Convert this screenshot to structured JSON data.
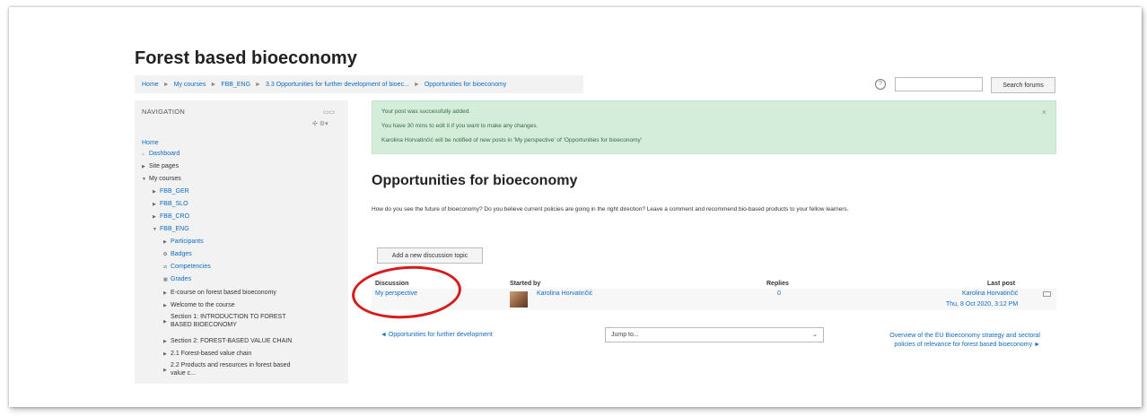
{
  "site": {
    "title": "Forest based bioeconomy"
  },
  "breadcrumb": [
    "Home",
    "My courses",
    "FBB_ENG",
    "3.3 Opportunities for further development of bioec...",
    "Opportunities for bioeconomy"
  ],
  "search": {
    "button_label": "Search forums",
    "placeholder": "",
    "help_glyph": "?"
  },
  "navigation": {
    "title": "NAVIGATION",
    "items": [
      {
        "label": "Home"
      },
      {
        "label": "Dashboard"
      },
      {
        "label": "Site pages"
      },
      {
        "label": "My courses"
      },
      {
        "label": "FBB_GER"
      },
      {
        "label": "FBB_SLO"
      },
      {
        "label": "FBB_CRO"
      },
      {
        "label": "FBB_ENG"
      },
      {
        "label": "Participants"
      },
      {
        "label": "Badges"
      },
      {
        "label": "Competencies"
      },
      {
        "label": "Grades"
      },
      {
        "label": "E-course on forest based bioeconomy"
      },
      {
        "label": "Welcome to the course"
      },
      {
        "label": "Section 1: INTRODUCTION TO FOREST",
        "label2": "BASED BIOECONOMY"
      },
      {
        "label": "Section 2: FOREST-BASED VALUE CHAIN"
      },
      {
        "label": "2.1 Forest-based value chain"
      },
      {
        "label": "2.2 Products and resources in forest based",
        "label2": "value c..."
      }
    ]
  },
  "alert": {
    "lines": [
      "Your post was successfully added.",
      "You have 30 mins to edit it if you want to make any changes.",
      "Karolina Horvatinčić will be notified of new posts in 'My perspective' of 'Opportunities for bioeconomy'"
    ],
    "close": "×"
  },
  "forum": {
    "title": "Opportunities for bioeconomy",
    "intro": "How do you see the future of bioeconomy? Do you believe current policies are going in the right direction? Leave a comment and recommend bio-based products to your fellow learners.",
    "add_button": "Add a new discussion topic"
  },
  "table": {
    "headers": {
      "discussion": "Discussion",
      "started_by": "Started by",
      "replies": "Replies",
      "last_post": "Last post"
    },
    "rows": [
      {
        "discussion": "My perspective",
        "started_by": "Karolina Horvatinčić",
        "replies": "0",
        "last_post_author": "Karolina Horvatinčić",
        "last_post_date": "Thu, 8 Oct 2020, 3:12 PM"
      }
    ]
  },
  "footer_nav": {
    "prev": "◄ Opportunities for further development",
    "jump_placeholder": "Jump to...",
    "next_line1": "Overview of the EU Bioeconomy strategy and sectoral",
    "next_line2": "policies of relevance for forest based bioeconomy ►"
  },
  "colors": {
    "link": "#0f6cbf",
    "success_bg": "#d4edda",
    "annotation": "#d91a1a"
  }
}
